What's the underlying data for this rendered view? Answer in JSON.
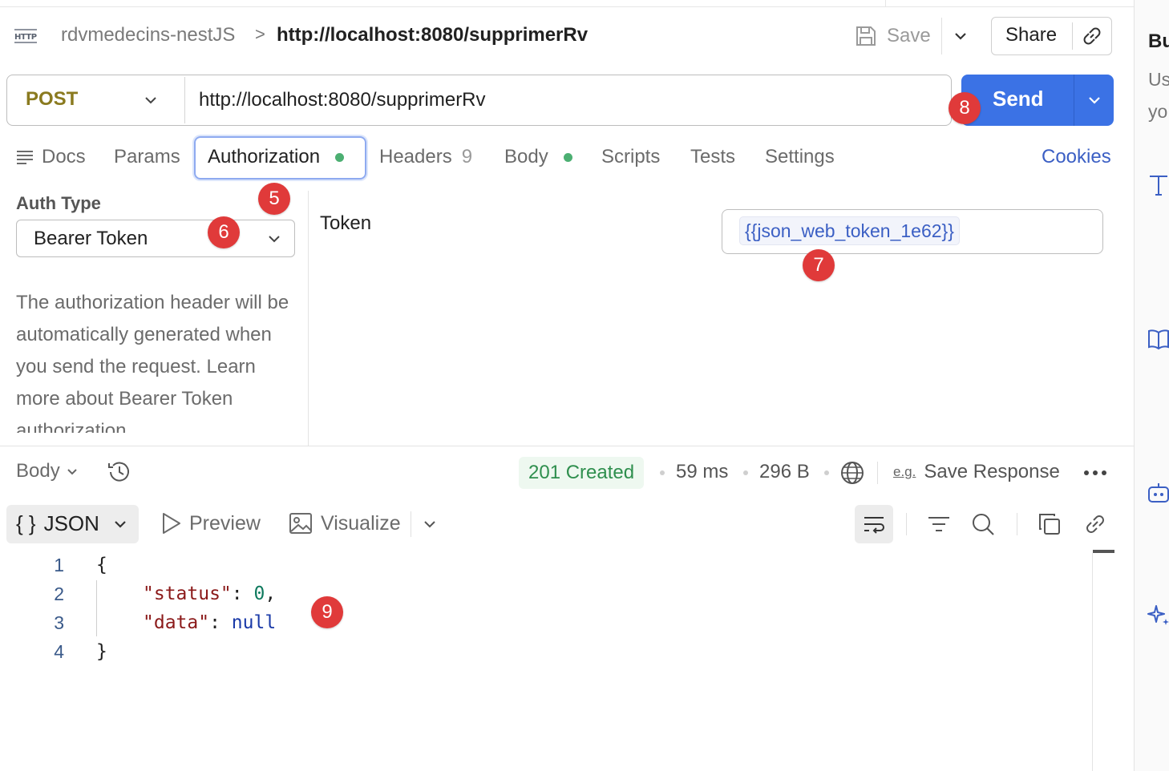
{
  "breadcrumb": {
    "protocol_icon_text": "HTTP",
    "collection": "rdvmedecins-nestJS",
    "separator": ">",
    "request": "http://localhost:8080/supprimerRv"
  },
  "header_actions": {
    "save_label": "Save",
    "share_label": "Share"
  },
  "request": {
    "method": "POST",
    "url": "http://localhost:8080/supprimerRv",
    "send_label": "Send"
  },
  "tabs": {
    "docs": "Docs",
    "params": "Params",
    "authorization": "Authorization",
    "headers": "Headers",
    "headers_count": "9",
    "body": "Body",
    "scripts": "Scripts",
    "tests": "Tests",
    "settings": "Settings",
    "cookies": "Cookies",
    "active": "Authorization"
  },
  "auth": {
    "type_label": "Auth Type",
    "type_value": "Bearer Token",
    "description": "The authorization header will be automatically generated when you send the request. Learn more about Bearer Token authorization.",
    "token_label": "Token",
    "token_value": "{{json_web_token_1e62}}"
  },
  "response": {
    "view_label": "Body",
    "status": "201 Created",
    "time": "59 ms",
    "size": "296 B",
    "save_eg": "e.g.",
    "save_label": "Save Response",
    "format_label": "JSON",
    "format_braces": "{ }",
    "preview_label": "Preview",
    "visualize_label": "Visualize",
    "code_lines": [
      {
        "n": "1",
        "text": "{"
      },
      {
        "n": "2",
        "key": "\"status\"",
        "value": "0",
        "trail": ","
      },
      {
        "n": "3",
        "key": "\"data\"",
        "value": "null"
      },
      {
        "n": "4",
        "text": "}"
      }
    ]
  },
  "annotations": [
    "5",
    "6",
    "7",
    "8",
    "9"
  ],
  "side_panel": {
    "title": "Bu",
    "text_line1": "Us",
    "text_line2": "yo"
  },
  "colors": {
    "method": "#8a7a1f",
    "send": "#3b72e5",
    "badge": "#e03a3a",
    "status_ok": "#2f8f4e",
    "link": "#3b5fc4"
  }
}
